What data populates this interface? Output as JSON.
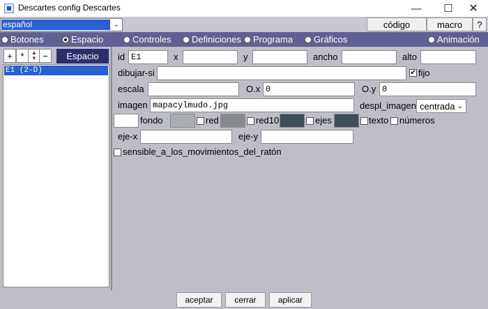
{
  "window": {
    "title": "Descartes config Descartes",
    "minimize": "—",
    "maximize": "☐",
    "close": "✕"
  },
  "language": {
    "value": "español",
    "arrow": "⌄"
  },
  "toolbar": {
    "codigo": "código",
    "macro": "macro",
    "help": "?"
  },
  "tabs": [
    {
      "label": "Botones",
      "selected": false
    },
    {
      "label": "Espacio",
      "selected": true
    },
    {
      "label": "Controles",
      "selected": false
    },
    {
      "label": "Definiciones",
      "selected": false
    },
    {
      "label": "Programa",
      "selected": false
    },
    {
      "label": "Gráficos",
      "selected": false
    },
    {
      "label": "Animación",
      "selected": false
    }
  ],
  "left": {
    "buttons": [
      "+",
      "*",
      "▲▼",
      "−"
    ],
    "header": "Espacio",
    "items": [
      "E1 (2-D)"
    ]
  },
  "form": {
    "id_label": "id",
    "id_value": "E1",
    "x_label": "x",
    "x_value": "",
    "y_label": "y",
    "y_value": "",
    "ancho_label": "ancho",
    "ancho_value": "",
    "alto_label": "alto",
    "alto_value": "",
    "dibujar_label": "dibujar-si",
    "dibujar_value": "",
    "fijo_label": "fijo",
    "fijo_checked": true,
    "escala_label": "escala",
    "escala_value": "",
    "ox_label": "O.x",
    "ox_value": "0",
    "oy_label": "O.y",
    "oy_value": "0",
    "imagen_label": "imagen",
    "imagen_value": "mapacylmudo.jpg",
    "despl_label": "despl_imagen",
    "despl_value": "centrada",
    "fondo_label": "fondo",
    "red_label": "red",
    "red10_label": "red10",
    "ejes_label": "ejes",
    "texto_label": "texto",
    "numeros_label": "números",
    "ejex_label": "eje-x",
    "ejex_value": "",
    "ejey_label": "eje-y",
    "ejey_value": "",
    "sensible_label": "sensible_a_los_movimientos_del_ratón"
  },
  "colors": {
    "fondo": "#ffffff",
    "red": "#a8adb0",
    "red10": "#878b8e",
    "ejes": "#3e4f5a",
    "texto": "#3e4f5a",
    "tabbar": "#606094",
    "selection": "#2a5fd4"
  },
  "footer": {
    "aceptar": "aceptar",
    "cerrar": "cerrar",
    "aplicar": "aplicar"
  }
}
